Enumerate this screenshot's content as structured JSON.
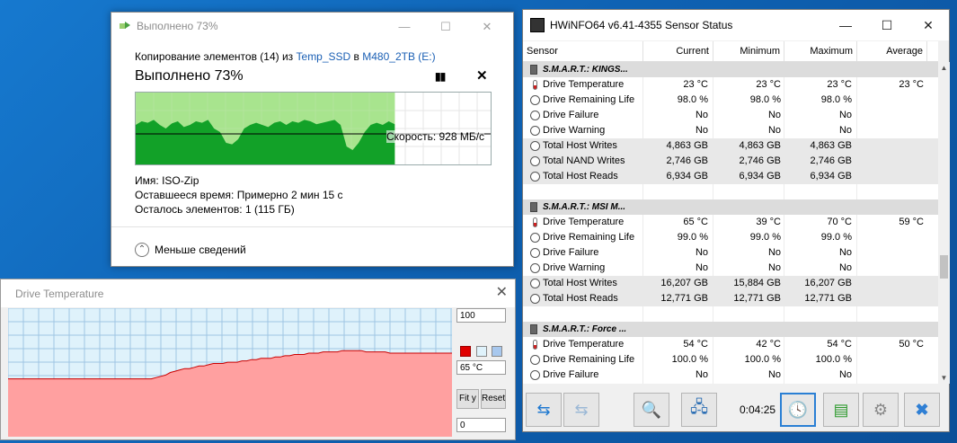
{
  "copy_dialog": {
    "title": "Выполнено 73%",
    "line_prefix": "Копирование элементов (14) из ",
    "source": "Temp_SSD",
    "in_word": " в ",
    "dest": "M480_2TB (E:)",
    "heading": "Выполнено 73%",
    "progress": 0.73,
    "speed_label": "Скорость: 928 МБ/с",
    "name_label": "Имя:",
    "name_value": "ISO-Zip",
    "time_label": "Оставшееся время:",
    "time_value": "Примерно 2 мин 15 с",
    "items_label": "Осталось элементов:",
    "items_value": "1 (115 ГБ)",
    "less_details": "Меньше сведений",
    "speed_profile": [
      0.55,
      0.6,
      0.58,
      0.62,
      0.55,
      0.5,
      0.57,
      0.6,
      0.52,
      0.55,
      0.6,
      0.58,
      0.62,
      0.5,
      0.45,
      0.3,
      0.28,
      0.35,
      0.5,
      0.55,
      0.58,
      0.55,
      0.52,
      0.58,
      0.6,
      0.55,
      0.6,
      0.58,
      0.62,
      0.6,
      0.56,
      0.58,
      0.6,
      0.62,
      0.55,
      0.25,
      0.2,
      0.3,
      0.45,
      0.55,
      0.58,
      0.55,
      0.6,
      0.56
    ]
  },
  "temp_window": {
    "title": "Drive Temperature",
    "max_value": "100",
    "current_value": "65 °C",
    "min_value": "0",
    "fit_button": "Fit y",
    "reset_button": "Reset",
    "colors": {
      "line": "#cc0000",
      "fill": "#ffa0a0",
      "bg": "#dff2fb"
    },
    "series": [
      45,
      45,
      45,
      45,
      45,
      45,
      45,
      45,
      45,
      45,
      45,
      45,
      45,
      45,
      45,
      45,
      45,
      45,
      45,
      45,
      45,
      45,
      45,
      45,
      45,
      45,
      45,
      45,
      45,
      45,
      45,
      46,
      47,
      48,
      50,
      51,
      52,
      53,
      53,
      54,
      55,
      55,
      56,
      57,
      57,
      57,
      58,
      58,
      58,
      59,
      59,
      60,
      60,
      61,
      61,
      61,
      62,
      62,
      63,
      63,
      64,
      64,
      64,
      65,
      65,
      65,
      66,
      66,
      66,
      66,
      67,
      67,
      67,
      67,
      67,
      66,
      66,
      66,
      66,
      66,
      65,
      65,
      65,
      65,
      65,
      65,
      65,
      65,
      65,
      65,
      65,
      65,
      65,
      65
    ]
  },
  "hwinfo": {
    "title": "HWiNFO64 v6.41-4355 Sensor Status",
    "columns": [
      "Sensor",
      "Current",
      "Minimum",
      "Maximum",
      "Average"
    ],
    "rows": [
      {
        "type": "group",
        "name": "S.M.A.R.T.: KINGS..."
      },
      {
        "icon": "therm",
        "name": "Drive Temperature",
        "cur": "23 °C",
        "min": "23 °C",
        "max": "23 °C",
        "avg": "23 °C"
      },
      {
        "icon": "clock",
        "name": "Drive Remaining Life",
        "cur": "98.0 %",
        "min": "98.0 %",
        "max": "98.0 %",
        "avg": ""
      },
      {
        "icon": "clock",
        "name": "Drive Failure",
        "cur": "No",
        "min": "No",
        "max": "No",
        "avg": ""
      },
      {
        "icon": "clock",
        "name": "Drive Warning",
        "cur": "No",
        "min": "No",
        "max": "No",
        "avg": ""
      },
      {
        "icon": "clock",
        "name": "Total Host Writes",
        "cur": "4,863 GB",
        "min": "4,863 GB",
        "max": "4,863 GB",
        "avg": ""
      },
      {
        "icon": "clock",
        "name": "Total NAND Writes",
        "cur": "2,746 GB",
        "min": "2,746 GB",
        "max": "2,746 GB",
        "avg": ""
      },
      {
        "icon": "clock",
        "name": "Total Host Reads",
        "cur": "6,934 GB",
        "min": "6,934 GB",
        "max": "6,934 GB",
        "avg": ""
      },
      {
        "type": "blank"
      },
      {
        "type": "group",
        "name": "S.M.A.R.T.: MSI M..."
      },
      {
        "icon": "therm",
        "name": "Drive Temperature",
        "cur": "65 °C",
        "min": "39 °C",
        "max": "70 °C",
        "avg": "59 °C"
      },
      {
        "icon": "clock",
        "name": "Drive Remaining Life",
        "cur": "99.0 %",
        "min": "99.0 %",
        "max": "99.0 %",
        "avg": ""
      },
      {
        "icon": "clock",
        "name": "Drive Failure",
        "cur": "No",
        "min": "No",
        "max": "No",
        "avg": ""
      },
      {
        "icon": "clock",
        "name": "Drive Warning",
        "cur": "No",
        "min": "No",
        "max": "No",
        "avg": ""
      },
      {
        "icon": "clock",
        "name": "Total Host Writes",
        "cur": "16,207 GB",
        "min": "15,884 GB",
        "max": "16,207 GB",
        "avg": ""
      },
      {
        "icon": "clock",
        "name": "Total Host Reads",
        "cur": "12,771 GB",
        "min": "12,771 GB",
        "max": "12,771 GB",
        "avg": ""
      },
      {
        "type": "blank"
      },
      {
        "type": "group",
        "name": "S.M.A.R.T.: Force ..."
      },
      {
        "icon": "therm",
        "name": "Drive Temperature",
        "cur": "54 °C",
        "min": "42 °C",
        "max": "54 °C",
        "avg": "50 °C"
      },
      {
        "icon": "clock",
        "name": "Drive Remaining Life",
        "cur": "100.0 %",
        "min": "100.0 %",
        "max": "100.0 %",
        "avg": ""
      },
      {
        "icon": "clock",
        "name": "Drive Failure",
        "cur": "No",
        "min": "No",
        "max": "No",
        "avg": ""
      }
    ],
    "timer": "0:04:25",
    "toolbar_icons": [
      "nav-arrows-icon",
      "nav-arrows-disabled-icon",
      "monitor-magnifier-icon",
      "network-icon",
      "clock-icon",
      "add-report-icon",
      "gear-icon",
      "close-x-icon"
    ]
  }
}
